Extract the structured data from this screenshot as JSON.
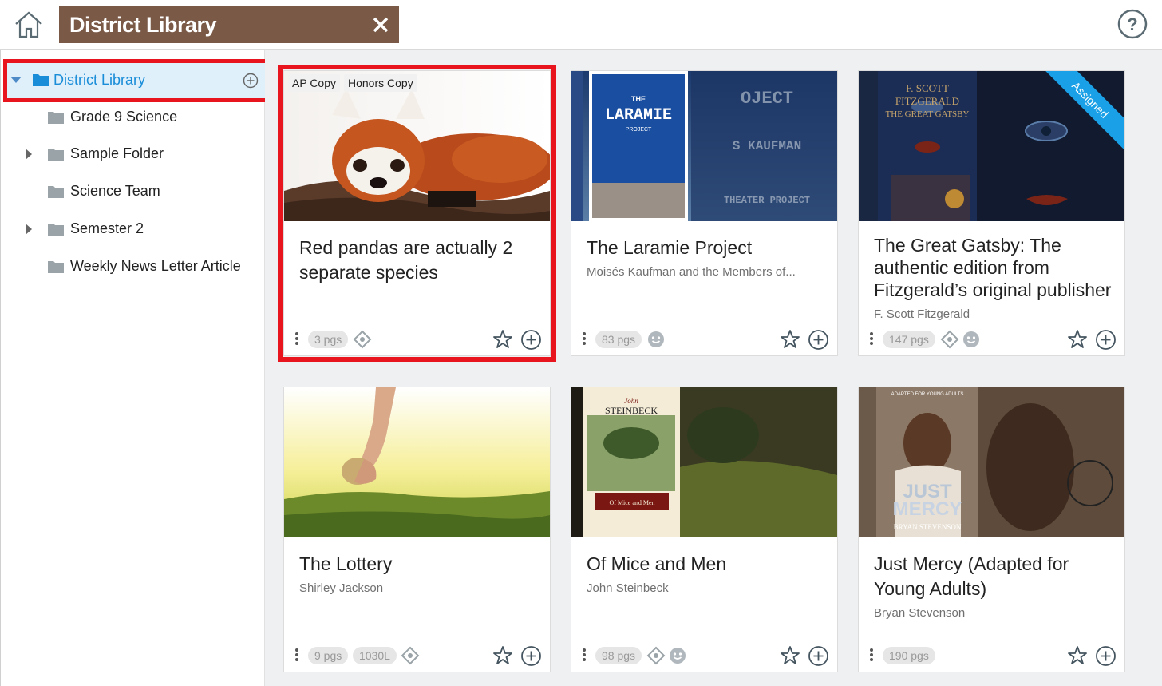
{
  "header": {
    "title": "District Library",
    "home_icon": "home-icon",
    "close_icon": "close-icon",
    "help_icon": "help-icon"
  },
  "sidebar": {
    "root": {
      "label": "District Library",
      "expanded": true,
      "selected": true
    },
    "items": [
      {
        "label": "Grade 9 Science",
        "expandable": false
      },
      {
        "label": "Sample Folder",
        "expandable": true
      },
      {
        "label": "Science Team",
        "expandable": false
      },
      {
        "label": "Semester 2",
        "expandable": true
      },
      {
        "label": "Weekly News Letter Article",
        "expandable": false
      }
    ]
  },
  "cards": [
    {
      "title": "Red pandas are actually 2 separate species",
      "author": "",
      "pages": "3 pgs",
      "lexile": "",
      "tags": [
        "AP Copy",
        "Honors Copy"
      ],
      "icons": [
        "nonfiction-icon"
      ],
      "assigned": false,
      "selected": true,
      "cover_text": ""
    },
    {
      "title": "The Laramie Project",
      "author": "Moisés Kaufman and the Members of...",
      "pages": "83 pgs",
      "lexile": "",
      "tags": [],
      "icons": [
        "drama-face-icon"
      ],
      "assigned": false,
      "selected": false,
      "cover_text": "THE LARAMIE PROJECT"
    },
    {
      "title": "The Great Gatsby: The authentic edition from Fitzgerald’s original publisher",
      "author": "F. Scott Fitzgerald",
      "pages": "147 pgs",
      "lexile": "",
      "tags": [],
      "icons": [
        "nonfiction-icon",
        "drama-face-icon"
      ],
      "assigned": true,
      "assigned_label": "Assigned",
      "selected": false,
      "cover_text": "F. SCOTT FITZGERALD THE GREAT GATSBY"
    },
    {
      "title": "The Lottery",
      "author": "Shirley Jackson",
      "pages": "9 pgs",
      "lexile": "1030L",
      "tags": [],
      "icons": [
        "nonfiction-icon"
      ],
      "assigned": false,
      "selected": false,
      "cover_text": ""
    },
    {
      "title": "Of Mice and Men",
      "author": "John Steinbeck",
      "pages": "98 pgs",
      "lexile": "",
      "tags": [],
      "icons": [
        "nonfiction-icon",
        "drama-face-icon"
      ],
      "assigned": false,
      "selected": false,
      "cover_text": "John STEINBECK Of Mice and Men"
    },
    {
      "title": "Just Mercy (Adapted for Young Adults)",
      "author": "Bryan Stevenson",
      "pages": "190 pgs",
      "lexile": "",
      "tags": [],
      "icons": [],
      "assigned": false,
      "selected": false,
      "cover_text": "JUST MERCY BRYAN STEVENSON"
    }
  ],
  "colors": {
    "header_bar": "#7a5947",
    "selection_outline": "#e8141e",
    "accent_blue": "#1a8dd8",
    "assigned_ribbon": "#1aa0e6"
  }
}
